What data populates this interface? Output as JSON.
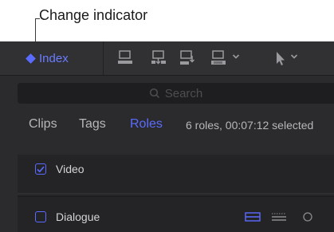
{
  "callout": {
    "label": "Change indicator"
  },
  "toolbar": {
    "index_label": "Index",
    "index_color": "#5a6bff",
    "icons": [
      "append-clip-icon",
      "insert-clip-icon",
      "connect-clip-icon",
      "overwrite-clip-icon",
      "select-tool-icon"
    ]
  },
  "search": {
    "placeholder": "Search"
  },
  "tabs": [
    {
      "label": "Clips",
      "active": false
    },
    {
      "label": "Tags",
      "active": false
    },
    {
      "label": "Roles",
      "active": true
    }
  ],
  "status": "6 roles, 00:07:12 selected",
  "roles": [
    {
      "label": "Video",
      "checked": true
    },
    {
      "label": "Dialogue",
      "checked": false
    }
  ],
  "colors": {
    "accent": "#5a6bff",
    "panel": "#2b2b2d",
    "text": "#b7b7bb"
  }
}
